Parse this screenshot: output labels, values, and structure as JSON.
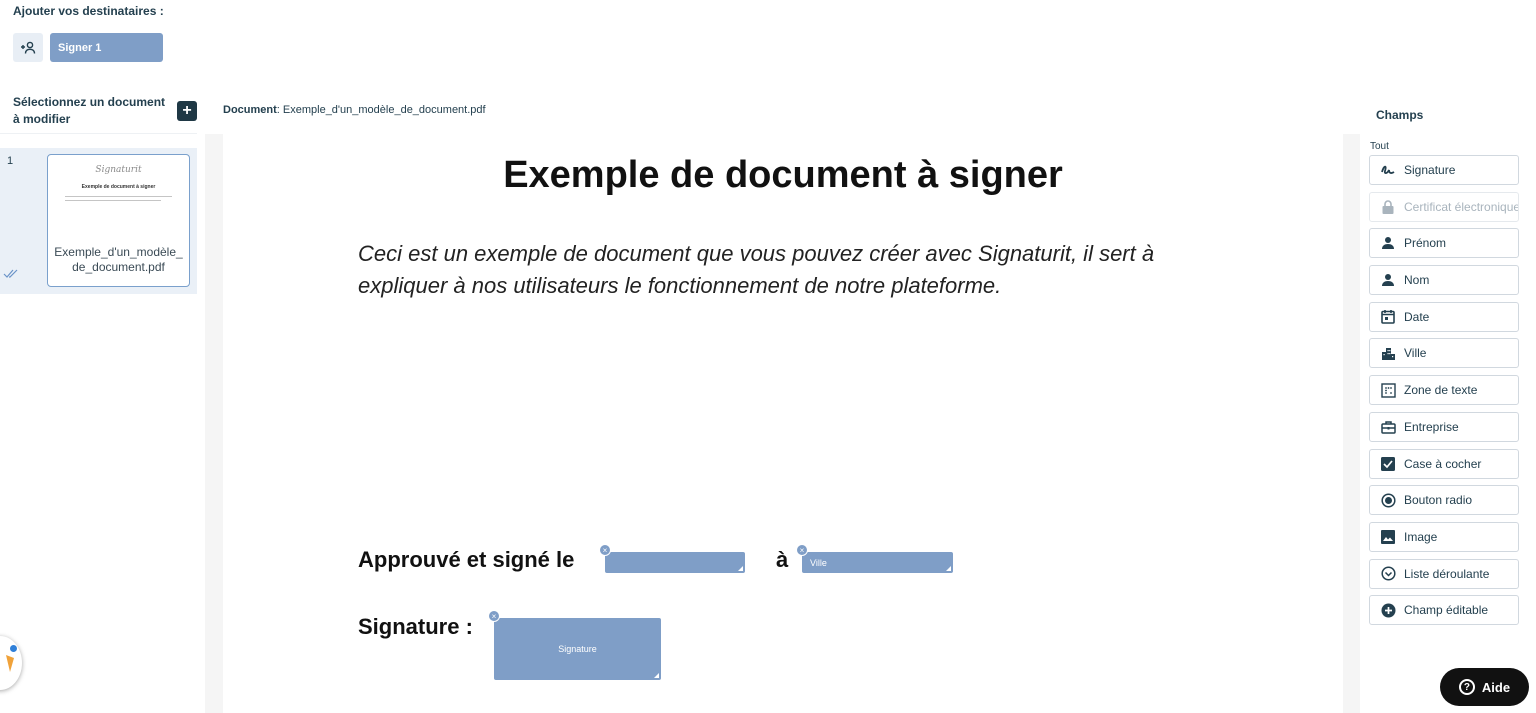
{
  "recipients": {
    "title": "Ajouter vos destinataires :",
    "signer_label": "Signer 1"
  },
  "documents": {
    "title": "Sélectionnez un document à modifier",
    "add_label": "+",
    "items": [
      {
        "index": "1",
        "name": "Exemple_d'un_modèle_de_document.pdf",
        "thumb_logo": "Signaturit",
        "thumb_title": "Exemple de document à signer"
      }
    ]
  },
  "viewer": {
    "label_prefix": "Document",
    "label_value": ": Exemple_d'un_modèle_de_document.pdf",
    "pdf_title": "Exemple de document à signer",
    "pdf_body": "Ceci est un exemple de document que vous pouvez créer avec Signaturit, il sert à expliquer à nos utilisateurs le fonctionnement de notre plateforme.",
    "approve_text": "Approuvé et signé le",
    "a_text": "à",
    "signature_text": "Signature :",
    "fields": {
      "date_label": "",
      "city_label": "Ville",
      "signature_label": "Signature",
      "remove_glyph": "×"
    }
  },
  "champs": {
    "title": "Champs",
    "filter": "Tout",
    "items": [
      {
        "label": "Signature",
        "icon": "signature-icon"
      },
      {
        "label": "Certificat électronique",
        "icon": "lock-icon",
        "disabled": true
      },
      {
        "label": "Prénom",
        "icon": "person-icon"
      },
      {
        "label": "Nom",
        "icon": "person-icon"
      },
      {
        "label": "Date",
        "icon": "calendar-icon"
      },
      {
        "label": "Ville",
        "icon": "city-icon"
      },
      {
        "label": "Zone de texte",
        "icon": "text-area-icon"
      },
      {
        "label": "Entreprise",
        "icon": "briefcase-icon"
      },
      {
        "label": "Case à cocher",
        "icon": "checkbox-icon"
      },
      {
        "label": "Bouton radio",
        "icon": "radio-icon"
      },
      {
        "label": "Image",
        "icon": "image-icon"
      },
      {
        "label": "Liste déroulante",
        "icon": "dropdown-icon"
      },
      {
        "label": "Champ éditable",
        "icon": "plus-circle-icon"
      }
    ]
  },
  "help": {
    "label": "Aide",
    "icon_glyph": "?"
  },
  "colors": {
    "field_blue": "#7f9ec7",
    "text_dark": "#24404f",
    "aide_bg": "#111111"
  }
}
